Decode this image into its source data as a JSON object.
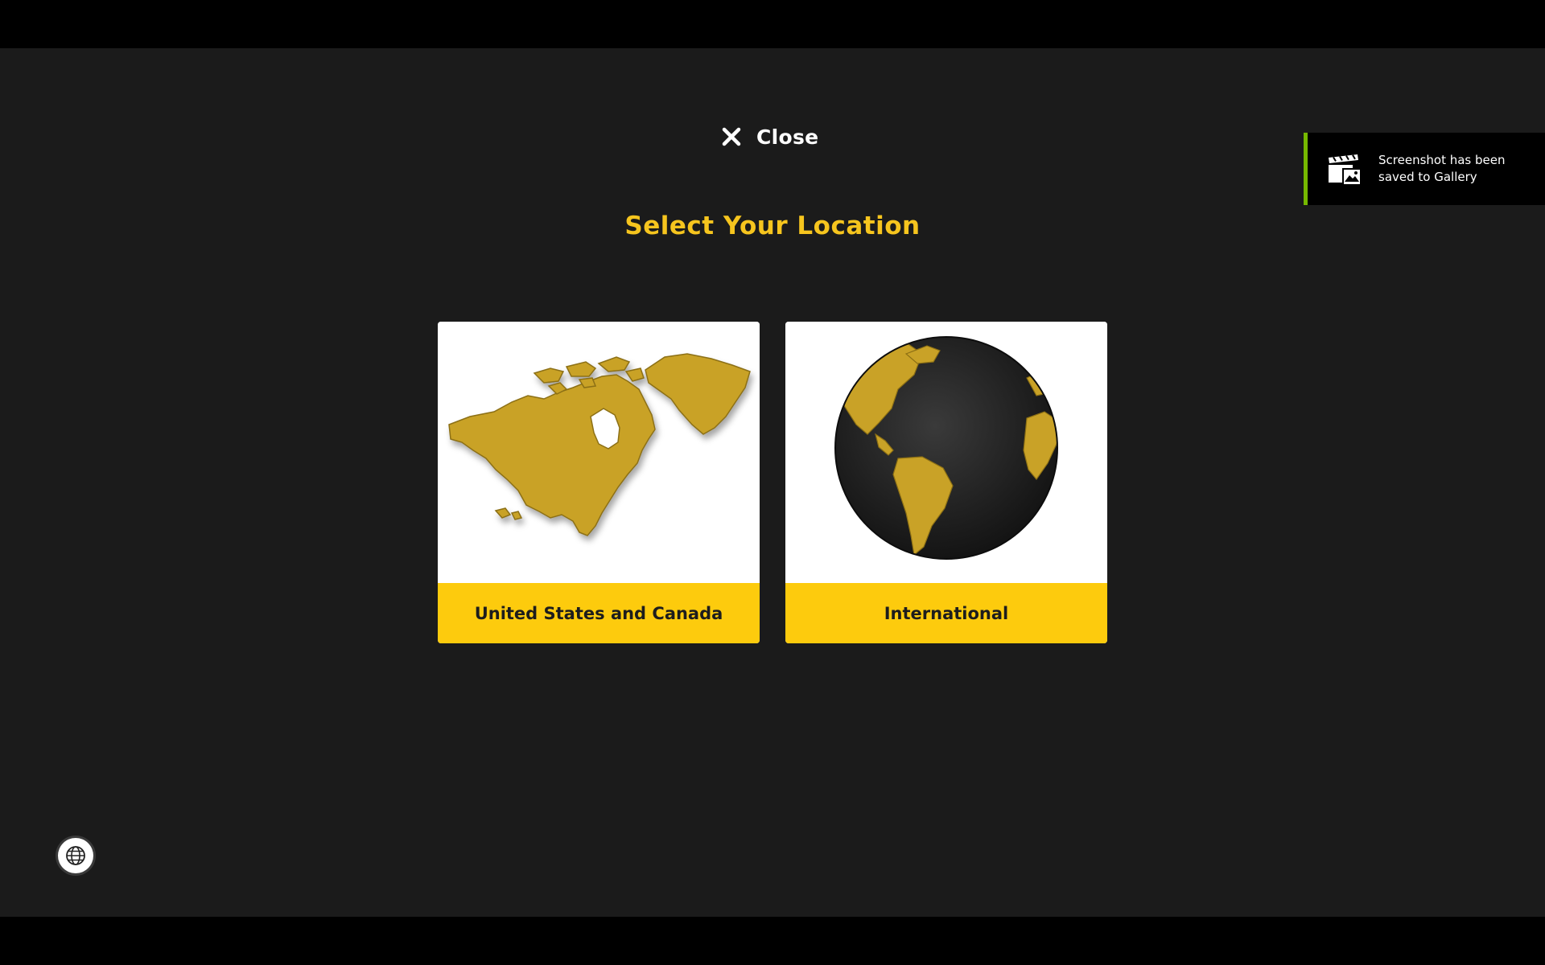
{
  "header": {
    "close_label": "Close",
    "close_icon": "close-icon"
  },
  "main": {
    "title": "Select Your Location",
    "options": [
      {
        "label": "United States and Canada",
        "icon": "north-america-map-icon"
      },
      {
        "label": "International",
        "icon": "globe-icon"
      }
    ]
  },
  "notification": {
    "message": "Screenshot has been saved to Gallery",
    "icon": "gallery-clapperboard-icon",
    "accent_color": "#76b900"
  },
  "footer": {
    "language_icon": "globe-language-icon"
  },
  "colors": {
    "background": "#1b1b1b",
    "title": "#f6c51e",
    "label_bar": "#fdcb0d",
    "label_text": "#1d1d1d",
    "map_gold": "#c9a227"
  }
}
